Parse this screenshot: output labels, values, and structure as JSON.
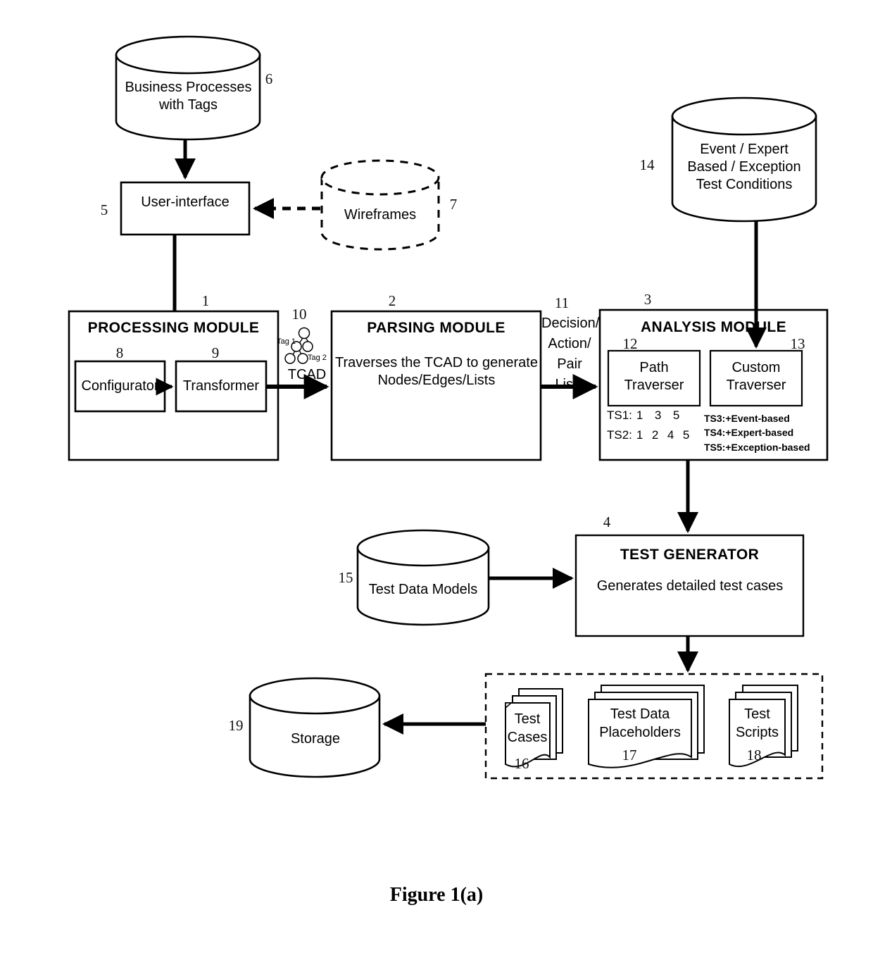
{
  "figure": {
    "caption": "Figure 1(a)"
  },
  "nodes": {
    "business_processes": {
      "ref": "6",
      "label": "Business Processes\nwith Tags"
    },
    "user_interface": {
      "ref": "5",
      "label": "User-interface"
    },
    "wireframes": {
      "ref": "7",
      "label": "Wireframes"
    },
    "test_conditions": {
      "ref": "14",
      "label": "Event / Expert\nBased / Exception\nTest Conditions"
    },
    "processing_module": {
      "ref": "1",
      "title": "PROCESSING MODULE"
    },
    "configurator": {
      "ref": "8",
      "label": "Configurator"
    },
    "transformer": {
      "ref": "9",
      "label": "Transformer"
    },
    "parsing_module": {
      "ref": "2",
      "title": "PARSING MODULE",
      "body": "Traverses the TCAD to generate\nNodes/Edges/Lists"
    },
    "analysis_module": {
      "ref": "3",
      "title": "ANALYSIS MODULE"
    },
    "path_traverser": {
      "ref": "12",
      "label": "Path\nTraverser"
    },
    "custom_traverser": {
      "ref": "13",
      "label": "Custom\nTraverser"
    },
    "test_generator": {
      "ref": "4",
      "title": "TEST GENERATOR",
      "body": "Generates detailed test cases"
    },
    "test_data_models": {
      "ref": "15",
      "label": "Test Data Models"
    },
    "test_cases": {
      "ref": "16",
      "label": "Test\nCases"
    },
    "test_data_placeholders": {
      "ref": "17",
      "label": "Test Data\nPlaceholders"
    },
    "test_scripts": {
      "ref": "18",
      "label": "Test\nScripts"
    },
    "storage": {
      "ref": "19",
      "label": "Storage"
    }
  },
  "tcad": {
    "ref": "10",
    "caption": "TCAD",
    "tag1": "Tag 1",
    "tag2": "Tag 2"
  },
  "edges": {
    "parsing_to_analysis": {
      "ref": "11",
      "label": "Decision/\nAction/\nPair Lists"
    }
  },
  "test_suites": {
    "path": [
      {
        "name": "TS1:",
        "steps": [
          "1",
          "3",
          "5"
        ]
      },
      {
        "name": "TS2:",
        "steps": [
          "1",
          "2",
          "4",
          "5"
        ]
      }
    ],
    "custom": [
      "TS3:+Event-based",
      "TS4:+Expert-based",
      "TS5:+Exception-based"
    ]
  },
  "colors": {
    "stroke": "#000000",
    "background": "#ffffff"
  }
}
